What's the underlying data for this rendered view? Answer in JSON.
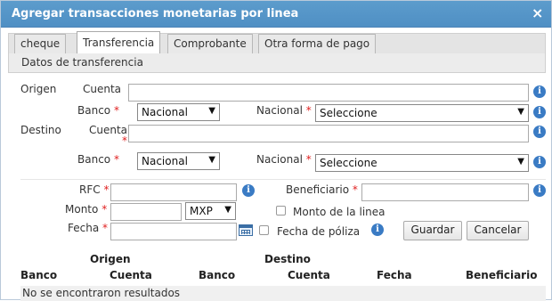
{
  "dialog": {
    "title": "Agregar transacciones monetarias por linea",
    "close_glyph": "×"
  },
  "tabs": [
    {
      "label": "cheque",
      "active": false
    },
    {
      "label": "Transferencia",
      "active": true
    },
    {
      "label": "Comprobante",
      "active": false
    },
    {
      "label": "Otra forma de pago",
      "active": false
    }
  ],
  "section_title": "Datos de transferencia",
  "required_mark": "*",
  "info_glyph": "i",
  "select_arrow": "▼",
  "origen": {
    "label": "Origen",
    "cuenta_label": "Cuenta",
    "cuenta_value": "",
    "banco_label": "Banco",
    "banco_value": "Nacional",
    "nacional_label": "Nacional",
    "nacional_value": "Seleccione"
  },
  "destino": {
    "label": "Destino",
    "cuenta_label": "Cuenta",
    "cuenta_value": "",
    "banco_label": "Banco",
    "banco_value": "Nacional",
    "nacional_label": "Nacional",
    "nacional_value": "Seleccione"
  },
  "rfc": {
    "label": "RFC",
    "value": ""
  },
  "beneficiario": {
    "label": "Beneficiario",
    "value": ""
  },
  "monto": {
    "label": "Monto",
    "value": "",
    "currency": "MXP"
  },
  "monto_linea": {
    "label": "Monto de la linea",
    "checked": false
  },
  "fecha": {
    "label": "Fecha",
    "value": ""
  },
  "fecha_poliza": {
    "label": "Fecha de póliza",
    "checked": false
  },
  "buttons": {
    "save": "Guardar",
    "cancel": "Cancelar"
  },
  "table": {
    "group_headers": [
      "Origen",
      "Destino"
    ],
    "columns": [
      "Banco",
      "Cuenta",
      "Banco",
      "Cuenta",
      "Fecha",
      "Beneficiario"
    ],
    "empty_message": "No se encontraron resultados"
  },
  "colors": {
    "titlebar": "#5c9ccc",
    "info": "#3a7bc4",
    "required": "#e02020"
  }
}
